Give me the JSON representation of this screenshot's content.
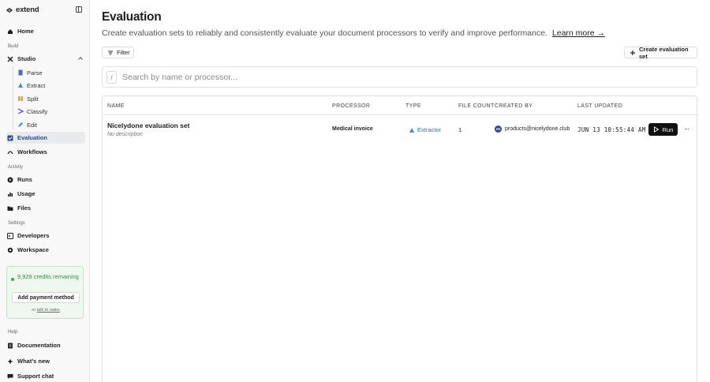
{
  "sidebar": {
    "brand": "extend",
    "home": "Home",
    "sections": {
      "build": "Build",
      "activity": "Activity",
      "settings": "Settings",
      "help": "Help"
    },
    "studio": "Studio",
    "studio_items": [
      "Parse",
      "Extract",
      "Split",
      "Classify",
      "Edit"
    ],
    "evaluation": "Evaluation",
    "workflows": "Workflows",
    "runs": "Runs",
    "usage": "Usage",
    "files": "Files",
    "developers": "Developers",
    "workspace": "Workspace",
    "credits": {
      "text": "9,928 credits remaining",
      "add_payment": "Add payment method",
      "or": "or",
      "talk_sales": "talk to sales"
    },
    "documentation": "Documentation",
    "whats_new": "What's new",
    "support_chat": "Support chat"
  },
  "main": {
    "title": "Evaluation",
    "subtitle": "Create evaluation sets to reliably and consistently evaluate your document processors to verify and improve performance.",
    "learn_more": "Learn more →",
    "filter_label": "Filter",
    "create_label": "Create evaluation set",
    "search_key": "/",
    "search_placeholder": "Search by name or processor..."
  },
  "table": {
    "headers": {
      "name": "NAME",
      "processor": "PROCESSOR",
      "type": "TYPE",
      "file_count": "FILE COUNT",
      "created_by": "CREATED BY",
      "last_updated": "LAST UPDATED"
    },
    "rows": [
      {
        "name": "Nicelydone evaluation set",
        "description": "No description",
        "processor": "Medical invoice",
        "type": "Extractor",
        "file_count": "1",
        "creator_initials": "PR",
        "created_by": "products@nicelydone.club",
        "last_updated": "JUN 13 10:55:44 AM",
        "run_label": "Run",
        "more": "···"
      }
    ]
  },
  "colors": {
    "accent": "#2d4a8a",
    "credits_green": "#3fa653",
    "type_blue": "#2d6ec4",
    "run_button": "#111111"
  }
}
